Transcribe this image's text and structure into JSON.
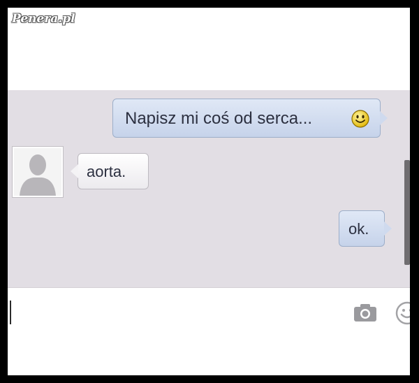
{
  "watermark": "Penera.pl",
  "messages": [
    {
      "direction": "outgoing",
      "text": "Napisz mi coś od serca...",
      "has_emoji": true,
      "emoji": "smiley-icon"
    },
    {
      "direction": "incoming",
      "text": "aorta."
    },
    {
      "direction": "outgoing",
      "text": "ok."
    }
  ],
  "input": {
    "placeholder": "",
    "value": ""
  },
  "icons": [
    "smiley-icon",
    "avatar-placeholder-icon",
    "camera-icon",
    "emoji-icon"
  ],
  "colors": {
    "chat_background": "#e2dee4",
    "outgoing_bubble": "#cfdaee",
    "incoming_bubble": "#f4f3f5",
    "frame": "#000000"
  }
}
